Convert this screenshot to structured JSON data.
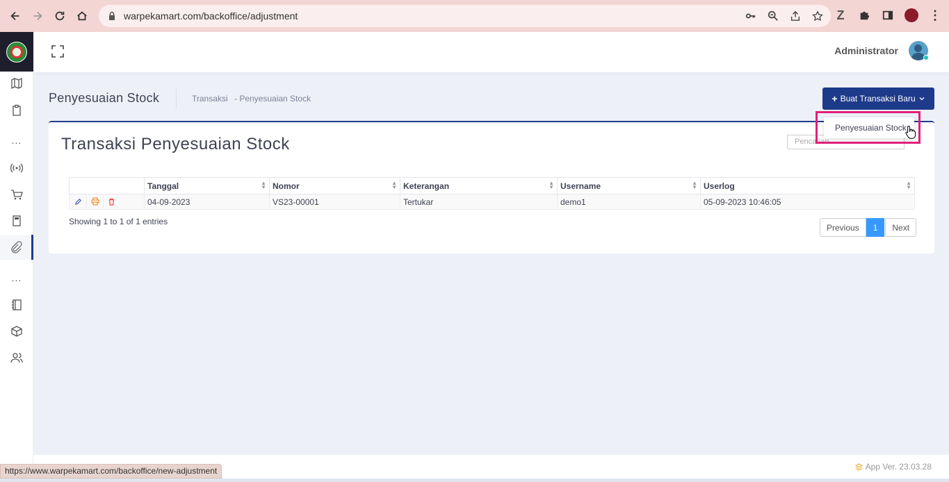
{
  "browser": {
    "url": "warpekamart.com/backoffice/adjustment",
    "status_url": "https://www.warpekamart.com/backoffice/new-adjustment"
  },
  "header": {
    "user_name": "Administrator"
  },
  "subheader": {
    "title": "Penyesuaian Stock",
    "breadcrumb": [
      "Transaksi",
      "- Penyesuaian Stock"
    ],
    "new_button_label": "Buat Transaksi Baru"
  },
  "dropdown": {
    "items": [
      "Penyesuaian Stock"
    ]
  },
  "card": {
    "title": "Transaksi Penyesuaian Stock",
    "search_placeholder": "Pencarian"
  },
  "table": {
    "columns": [
      "Tanggal",
      "Nomor",
      "Keterangan",
      "Username",
      "Userlog"
    ],
    "rows": [
      {
        "tanggal": "04-09-2023",
        "nomor": "VS23-00001",
        "keterangan": "Tertukar",
        "username": "demo1",
        "userlog": "05-09-2023 10:46:05"
      }
    ],
    "info": "Showing 1 to 1 of 1 entries",
    "pagination": {
      "previous": "Previous",
      "current": "1",
      "next": "Next"
    }
  },
  "footer": {
    "version": "App Ver. 23.03.28"
  },
  "colors": {
    "primary": "#1e3a8a",
    "page_active": "#3699ff",
    "highlight": "#e0207a",
    "edit_icon": "#3f51b5",
    "print_icon": "#f57c00",
    "delete_icon": "#e53935"
  }
}
